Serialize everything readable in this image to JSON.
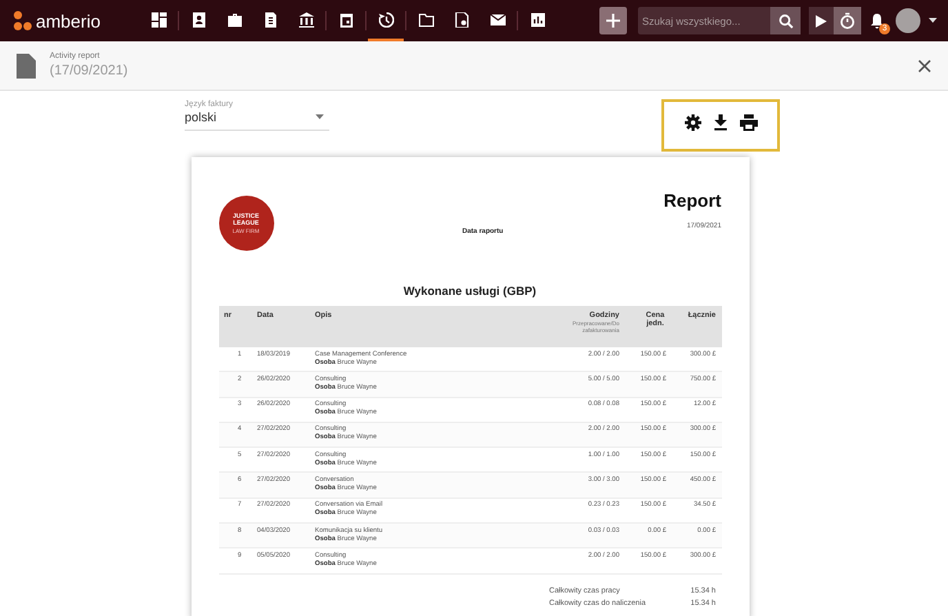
{
  "nav": {
    "logo": "amberio",
    "items": [
      {
        "selected": false
      },
      {
        "selected": false
      },
      {
        "selected": false
      },
      {
        "selected": false
      },
      {
        "selected": false
      },
      {
        "selected": false
      },
      {
        "selected": true
      },
      {
        "selected": false
      },
      {
        "selected": false
      },
      {
        "selected": false
      },
      {
        "selected": false
      }
    ],
    "search": {
      "placeholder": "Szukaj wszystkiego..."
    },
    "notification_count": "3"
  },
  "header": {
    "label": "Activity report",
    "date": "(17/09/2021)"
  },
  "language": {
    "label": "Język faktury",
    "value": "polski"
  },
  "report": {
    "logo_lines": [
      "JUSTICE",
      "LEAGUE",
      "LAW FIRM"
    ],
    "title": "Report",
    "date_label": "Data raportu",
    "date": "17/09/2021",
    "section": "Wykonane usługi (GBP)",
    "columns": [
      {
        "label": "nr"
      },
      {
        "label": "Data"
      },
      {
        "label": "Opis"
      },
      {
        "label": "Godziny",
        "note": "Przepracowane/Do zafakturowania"
      },
      {
        "label": "Cena jedn."
      },
      {
        "label": "Łącznie"
      }
    ],
    "rows": [
      {
        "nr": "1",
        "date": "18/03/2019",
        "desc": "Case Management Conference",
        "person": "**Osoba** Bruce Wayne",
        "hours": "2.00 / 2.00",
        "price": "150.00 £",
        "total": "300.00 £"
      },
      {
        "nr": "2",
        "date": "26/02/2020",
        "desc": "Consulting",
        "person": "**Osoba** Bruce Wayne",
        "hours": "5.00 / 5.00",
        "price": "150.00 £",
        "total": "750.00 £"
      },
      {
        "nr": "3",
        "date": "26/02/2020",
        "desc": "Consulting",
        "person": "**Osoba** Bruce Wayne",
        "hours": "0.08 / 0.08",
        "price": "150.00 £",
        "total": "12.00 £"
      },
      {
        "nr": "4",
        "date": "27/02/2020",
        "desc": "Consulting",
        "person": "**Osoba** Bruce Wayne",
        "hours": "2.00 / 2.00",
        "price": "150.00 £",
        "total": "300.00 £"
      },
      {
        "nr": "5",
        "date": "27/02/2020",
        "desc": "Consulting",
        "person": "**Osoba** Bruce Wayne",
        "hours": "1.00 / 1.00",
        "price": "150.00 £",
        "total": "150.00 £"
      },
      {
        "nr": "6",
        "date": "27/02/2020",
        "desc": "Conversation",
        "person": "**Osoba** Bruce Wayne",
        "hours": "3.00 / 3.00",
        "price": "150.00 £",
        "total": "450.00 £"
      },
      {
        "nr": "7",
        "date": "27/02/2020",
        "desc": "Conversation via Email",
        "person": "**Osoba** Bruce Wayne",
        "hours": "0.23 / 0.23",
        "price": "150.00 £",
        "total": "34.50 £"
      },
      {
        "nr": "8",
        "date": "04/03/2020",
        "desc": "Komunikacja su klientu",
        "person": "**Osoba** Bruce Wayne",
        "hours": "0.03 / 0.03",
        "price": "0.00 £",
        "total": "0.00 £"
      },
      {
        "nr": "9",
        "date": "05/05/2020",
        "desc": "Consulting",
        "person": "**Osoba** Bruce Wayne",
        "hours": "2.00 / 2.00",
        "price": "150.00 £",
        "total": "300.00 £"
      }
    ],
    "totals": [
      {
        "label": "Całkowity czas pracy",
        "value": "15.34 h"
      },
      {
        "label": "Całkowity czas do naliczenia",
        "value": "15.34 h"
      }
    ]
  }
}
